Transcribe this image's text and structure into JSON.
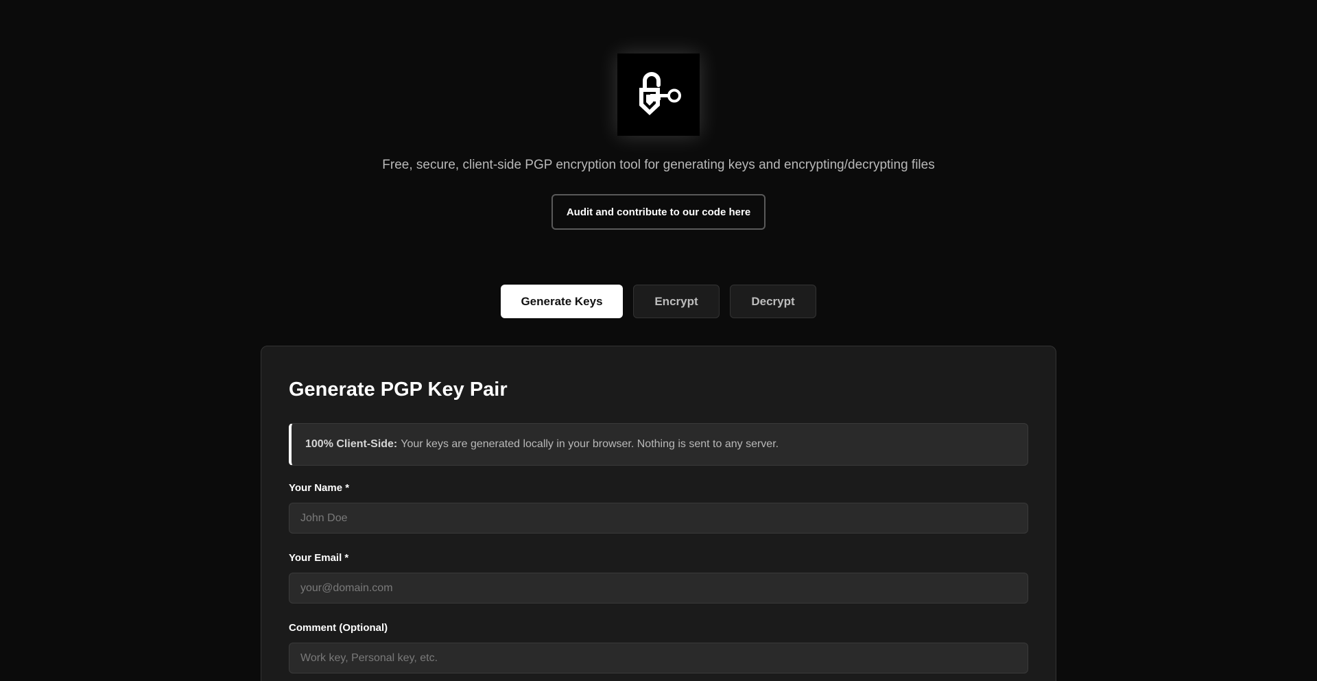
{
  "header": {
    "logo_icon": "lock-key-icon",
    "tagline": "Free, secure, client-side PGP encryption tool for generating keys and encrypting/decrypting files",
    "audit_button_label": "Audit and contribute to our code here"
  },
  "tabs": [
    {
      "label": "Generate Keys",
      "active": true
    },
    {
      "label": "Encrypt",
      "active": false
    },
    {
      "label": "Decrypt",
      "active": false
    }
  ],
  "card": {
    "title": "Generate PGP Key Pair",
    "notice": {
      "strong": "100% Client-Side:",
      "text": "Your keys are generated locally in your browser. Nothing is sent to any server."
    },
    "fields": {
      "name": {
        "label": "Your Name *",
        "placeholder": "John Doe",
        "value": ""
      },
      "email": {
        "label": "Your Email *",
        "placeholder": "your@domain.com",
        "value": ""
      },
      "comment": {
        "label": "Comment (Optional)",
        "placeholder": "Work key, Personal key, etc.",
        "value": ""
      }
    }
  },
  "colors": {
    "background": "#0b0b0b",
    "card": "#1b1b1b",
    "input": "#2a2a2a",
    "active_tab": "#ffffff",
    "text": "#ffffff",
    "muted_text": "#b9b9b9"
  }
}
